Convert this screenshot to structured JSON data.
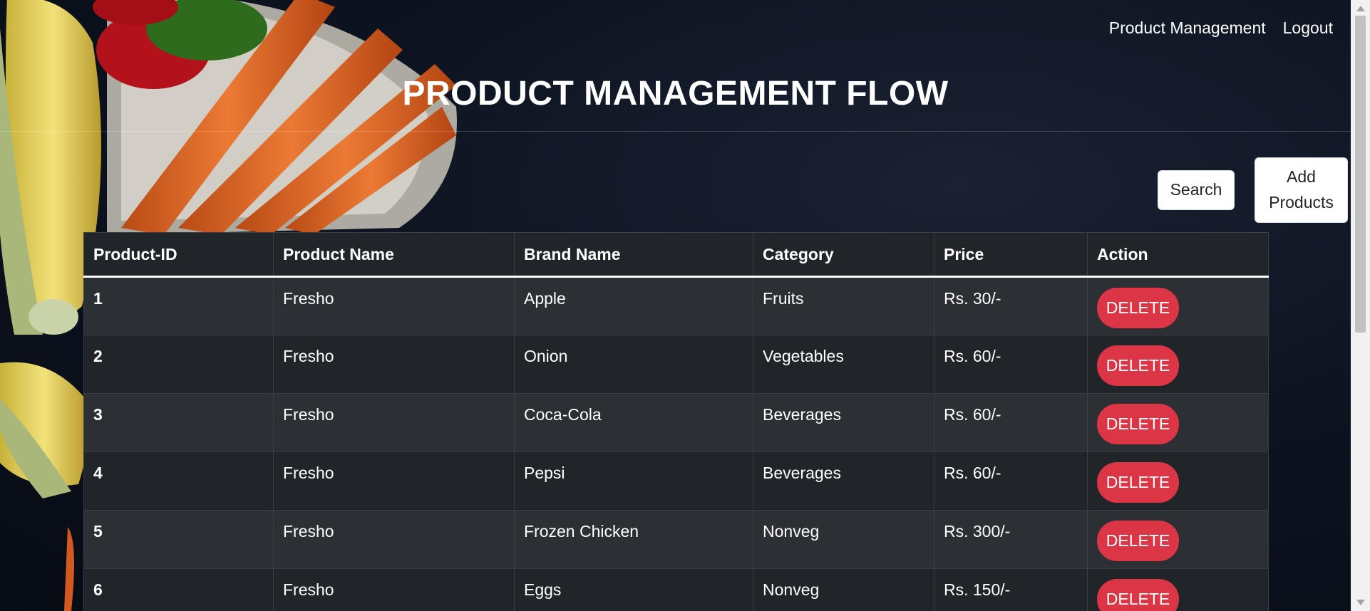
{
  "nav": {
    "product_management": "Product Management",
    "logout": "Logout"
  },
  "header": {
    "title": "PRODUCT MANAGEMENT FLOW"
  },
  "toolbar": {
    "search_label": "Search",
    "add_label": "Add\nProducts"
  },
  "table": {
    "columns": [
      "Product-ID",
      "Product Name",
      "Brand Name",
      "Category",
      "Price",
      "Action"
    ],
    "rows": [
      {
        "id": "1",
        "product": "Fresho",
        "brand": "Apple",
        "category": "Fruits",
        "price": "Rs. 30/-",
        "action": "DELETE"
      },
      {
        "id": "2",
        "product": "Fresho",
        "brand": "Onion",
        "category": "Vegetables",
        "price": "Rs. 60/-",
        "action": "DELETE"
      },
      {
        "id": "3",
        "product": "Fresho",
        "brand": "Coca-Cola",
        "category": "Beverages",
        "price": "Rs. 60/-",
        "action": "DELETE"
      },
      {
        "id": "4",
        "product": "Fresho",
        "brand": "Pepsi",
        "category": "Beverages",
        "price": "Rs. 60/-",
        "action": "DELETE"
      },
      {
        "id": "5",
        "product": "Fresho",
        "brand": "Frozen Chicken",
        "category": "Nonveg",
        "price": "Rs. 300/-",
        "action": "DELETE"
      },
      {
        "id": "6",
        "product": "Fresho",
        "brand": "Eggs",
        "category": "Nonveg",
        "price": "Rs. 150/-",
        "action": "DELETE"
      }
    ]
  },
  "colors": {
    "delete_button": "#dc3545",
    "table_dark": "#212529",
    "table_striped": "#2c3034",
    "page_background": "#0d1421"
  }
}
